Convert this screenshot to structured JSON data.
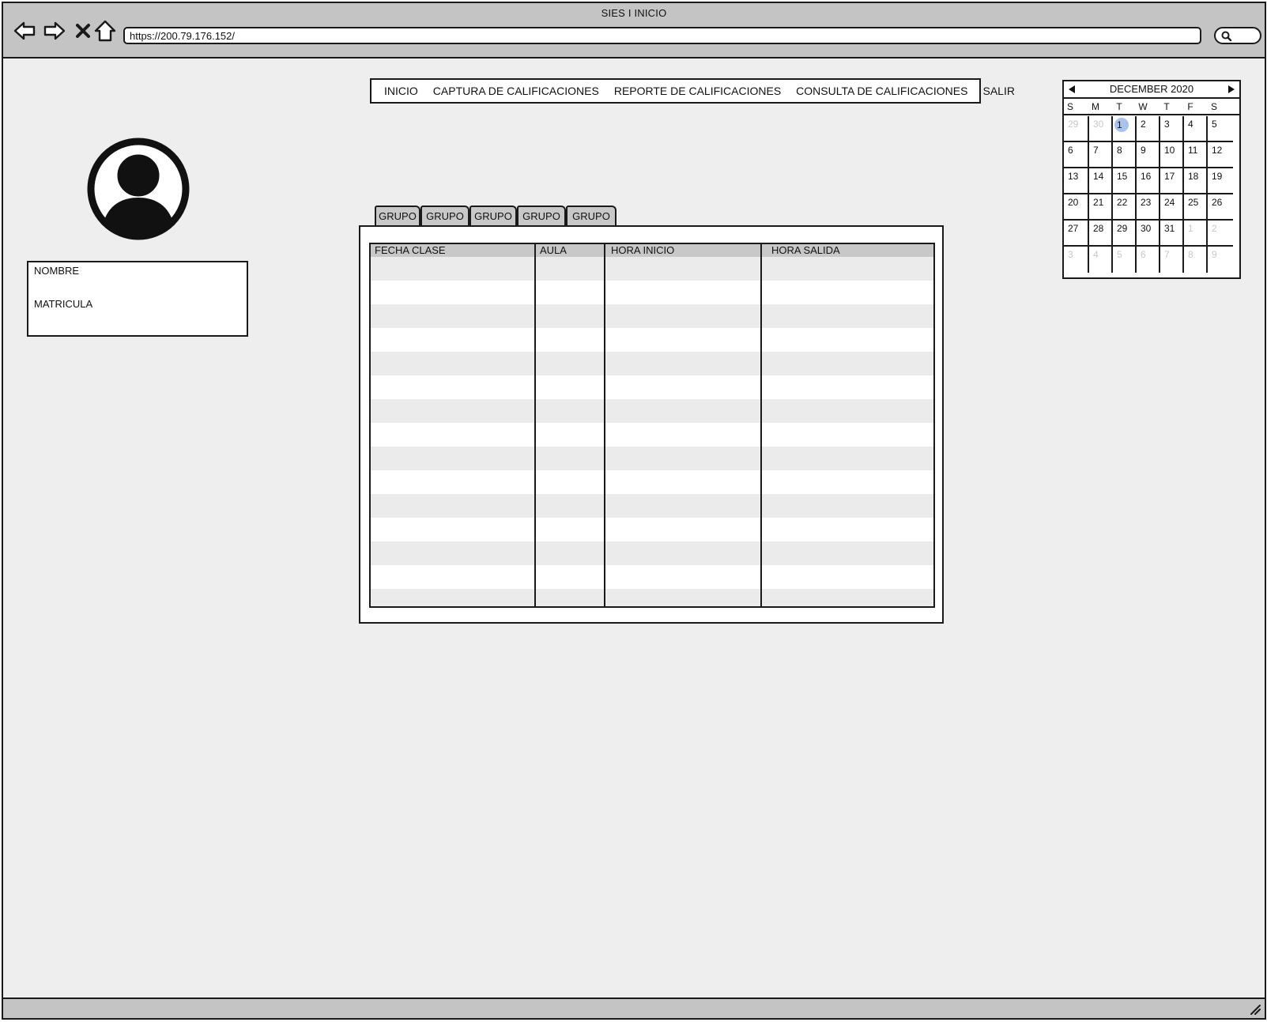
{
  "window": {
    "title": "SIES I INICIO"
  },
  "toolbar": {
    "back_icon": "back-arrow-icon",
    "forward_icon": "forward-arrow-icon",
    "stop_icon": "close-icon",
    "home_icon": "home-icon",
    "url": "https://200.79.176.152/",
    "search_icon": "search-icon"
  },
  "menu": {
    "items": [
      {
        "label": "INICIO"
      },
      {
        "label": "CAPTURA DE CALIFICACIONES"
      },
      {
        "label": "REPORTE DE CALIFICACIONES"
      },
      {
        "label": "CONSULTA DE CALIFICACIONES"
      },
      {
        "label": "SALIR"
      }
    ]
  },
  "profile": {
    "avatar_icon": "user-avatar-icon",
    "nombre_label": "NOMBRE",
    "matricula_label": "MATRICULA"
  },
  "tabs": [
    {
      "label": "GRUPO"
    },
    {
      "label": "GRUPO"
    },
    {
      "label": "GRUPO"
    },
    {
      "label": "GRUPO"
    },
    {
      "label": "GRUPO"
    }
  ],
  "table": {
    "columns": [
      "FECHA CLASE",
      "AULA",
      "HORA INICIO",
      "HORA SALIDA"
    ],
    "rows": 15
  },
  "calendar": {
    "month_label": "DECEMBER 2020",
    "weekdays": [
      "S",
      "M",
      "T",
      "W",
      "T",
      "F",
      "S"
    ],
    "selected_day": 1,
    "weeks": [
      [
        {
          "d": "29",
          "m": true
        },
        {
          "d": "30",
          "m": true
        },
        {
          "d": "1"
        },
        {
          "d": "2"
        },
        {
          "d": "3"
        },
        {
          "d": "4"
        },
        {
          "d": "5"
        }
      ],
      [
        {
          "d": "6"
        },
        {
          "d": "7"
        },
        {
          "d": "8"
        },
        {
          "d": "9"
        },
        {
          "d": "10"
        },
        {
          "d": "11"
        },
        {
          "d": "12"
        }
      ],
      [
        {
          "d": "13"
        },
        {
          "d": "14"
        },
        {
          "d": "15"
        },
        {
          "d": "16"
        },
        {
          "d": "17"
        },
        {
          "d": "18"
        },
        {
          "d": "19"
        }
      ],
      [
        {
          "d": "20"
        },
        {
          "d": "21"
        },
        {
          "d": "22"
        },
        {
          "d": "23"
        },
        {
          "d": "24"
        },
        {
          "d": "25"
        },
        {
          "d": "26"
        }
      ],
      [
        {
          "d": "27"
        },
        {
          "d": "28"
        },
        {
          "d": "29"
        },
        {
          "d": "30"
        },
        {
          "d": "31"
        },
        {
          "d": "1",
          "m": true
        },
        {
          "d": "2",
          "m": true
        }
      ],
      [
        {
          "d": "3",
          "m": true
        },
        {
          "d": "4",
          "m": true
        },
        {
          "d": "5",
          "m": true
        },
        {
          "d": "6",
          "m": true
        },
        {
          "d": "7",
          "m": true
        },
        {
          "d": "8",
          "m": true
        },
        {
          "d": "9",
          "m": true
        }
      ]
    ]
  },
  "colors": {
    "chrome": "#c4c4c4",
    "page_bg": "#eeeeee",
    "stripe": "#ebebeb",
    "selected_day": "#a8c4ec",
    "muted_day": "#c8c8c8"
  }
}
